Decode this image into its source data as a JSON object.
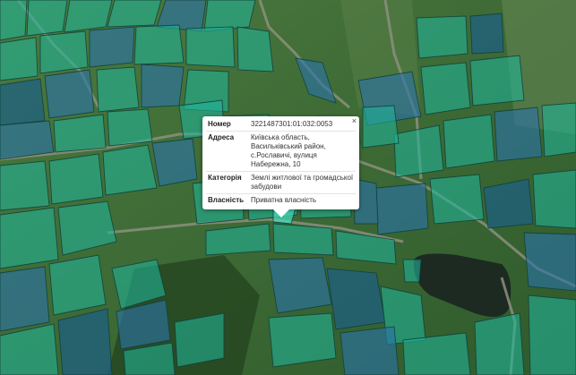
{
  "map": {
    "type": "satellite cadastral map",
    "parcel_colors": {
      "teal": "#20b59a",
      "blue": "#2c73a8",
      "highlight": "#46dfc0",
      "border": "#0f3f3b"
    }
  },
  "popup": {
    "close_icon": "×",
    "rows": [
      {
        "label": "Номер",
        "value": "3221487301:01:032:0053"
      },
      {
        "label": "Адреса",
        "value": "Київська область, Васильківський район, с.Рославичі, вулиця Набережна, 10"
      },
      {
        "label": "Категорія",
        "value": "Землі житлової та громадської забудови"
      },
      {
        "label": "Власність",
        "value": "Приватна власність"
      }
    ]
  }
}
